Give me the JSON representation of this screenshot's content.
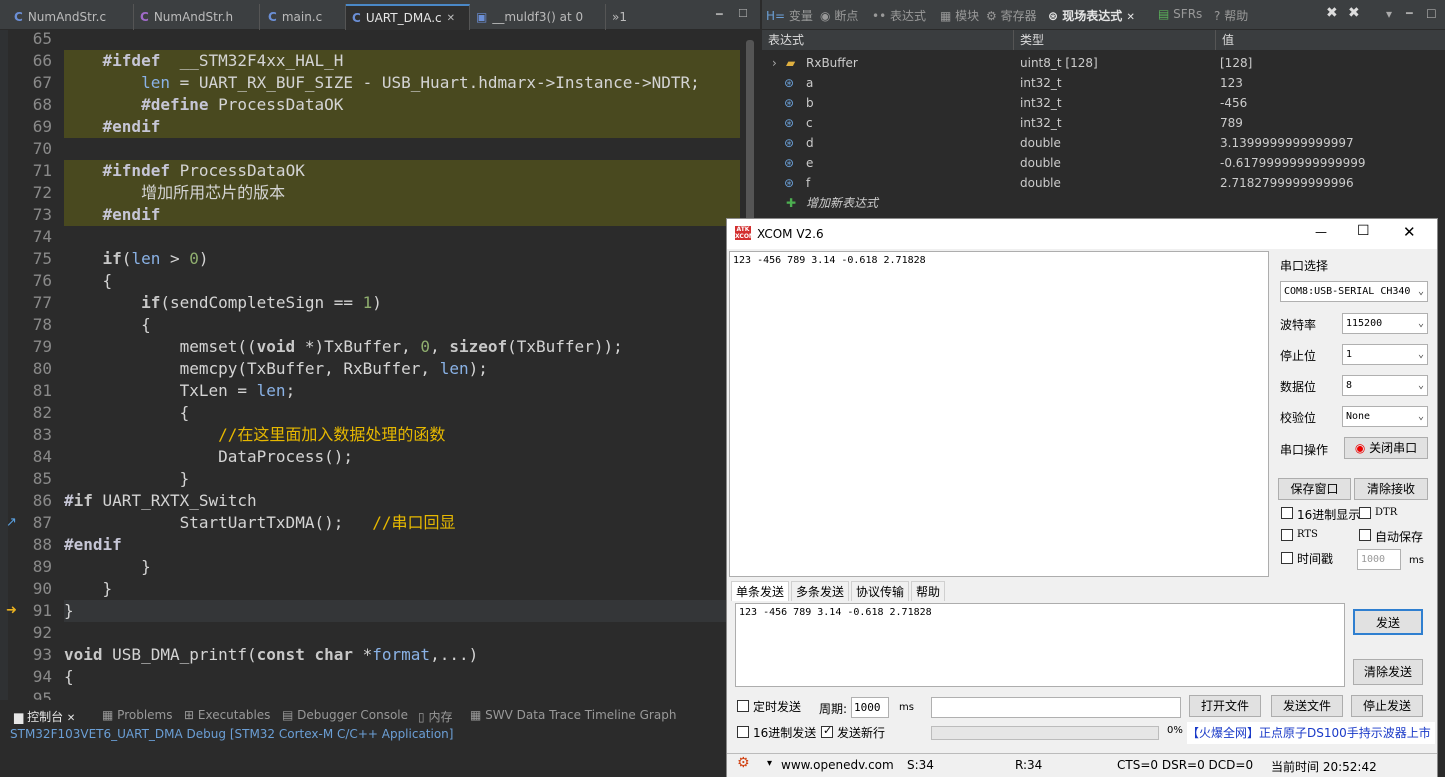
{
  "editor_tabs": [
    {
      "label": "NumAndStr.c",
      "type": "c"
    },
    {
      "label": "NumAndStr.h",
      "type": "h"
    },
    {
      "label": "main.c",
      "type": "c"
    },
    {
      "label": "UART_DMA.c",
      "type": "c"
    },
    {
      "label": "__muldf3() at 0",
      "type": "disasm"
    },
    {
      "label": "»1",
      "type": "more"
    }
  ],
  "code_lines": [
    {
      "n": "65",
      "t": ""
    },
    {
      "n": "66",
      "t": "    #ifdef  __STM32F4xx_HAL_H"
    },
    {
      "n": "67",
      "t": "        len = UART_RX_BUF_SIZE - USB_Huart.hdmarx->Instance->NDTR;"
    },
    {
      "n": "68",
      "t": "        #define ProcessDataOK"
    },
    {
      "n": "69",
      "t": "    #endif"
    },
    {
      "n": "70",
      "t": ""
    },
    {
      "n": "71",
      "t": "    #ifndef ProcessDataOK"
    },
    {
      "n": "72",
      "t": "        增加所用芯片的版本"
    },
    {
      "n": "73",
      "t": "    #endif"
    },
    {
      "n": "74",
      "t": ""
    },
    {
      "n": "75",
      "t": "    if(len > 0)"
    },
    {
      "n": "76",
      "t": "    {"
    },
    {
      "n": "77",
      "t": "        if(sendCompleteSign == 1)"
    },
    {
      "n": "78",
      "t": "        {"
    },
    {
      "n": "79",
      "t": "            memset((void *)TxBuffer, 0, sizeof(TxBuffer));"
    },
    {
      "n": "80",
      "t": "            memcpy(TxBuffer, RxBuffer, len);"
    },
    {
      "n": "81",
      "t": "            TxLen = len;"
    },
    {
      "n": "82",
      "t": "            {"
    },
    {
      "n": "83",
      "t": "                //在这里面加入数据处理的函数"
    },
    {
      "n": "84",
      "t": "                DataProcess();"
    },
    {
      "n": "85",
      "t": "            }"
    },
    {
      "n": "86",
      "t": "#if UART_RXTX_Switch"
    },
    {
      "n": "87",
      "t": "            StartUartTxDMA();   //串口回显"
    },
    {
      "n": "88",
      "t": "#endif"
    },
    {
      "n": "89",
      "t": "        }"
    },
    {
      "n": "90",
      "t": "    }"
    },
    {
      "n": "91",
      "t": "}"
    },
    {
      "n": "92",
      "t": ""
    },
    {
      "n": "93",
      "t": "void USB_DMA_printf(const char *format,...)"
    },
    {
      "n": "94",
      "t": "{"
    },
    {
      "n": "95",
      "t": ""
    }
  ],
  "right_tabs": [
    "变量",
    "断点",
    "表达式",
    "模块",
    "寄存器",
    "现场表达式",
    "SFRs",
    "帮助"
  ],
  "watch": {
    "headers": {
      "expr": "表达式",
      "type": "类型",
      "value": "值"
    },
    "rows": [
      {
        "expr": "RxBuffer",
        "type": "uint8_t [128]",
        "value": "[128]"
      },
      {
        "expr": "a",
        "type": "int32_t",
        "value": "123"
      },
      {
        "expr": "b",
        "type": "int32_t",
        "value": "-456"
      },
      {
        "expr": "c",
        "type": "int32_t",
        "value": "789"
      },
      {
        "expr": "d",
        "type": "double",
        "value": "3.1399999999999997"
      },
      {
        "expr": "e",
        "type": "double",
        "value": "-0.61799999999999999"
      },
      {
        "expr": "f",
        "type": "double",
        "value": "2.7182799999999996"
      }
    ],
    "add_label": "增加新表达式"
  },
  "console": {
    "tabs": [
      "控制台",
      "Problems",
      "Executables",
      "Debugger Console",
      "内存",
      "SWV Data Trace Timeline Graph"
    ],
    "status": "STM32F103VET6_UART_DMA Debug [STM32 Cortex-M C/C++ Application]"
  },
  "xcom": {
    "title": "XCOM V2.6",
    "receive_text": "123 -456 789 3.14 -0.618 2.71828",
    "port_label": "串口选择",
    "port_value": "COM8:USB-SERIAL CH340",
    "baud_label": "波特率",
    "baud_value": "115200",
    "stop_label": "停止位",
    "stop_value": "1",
    "data_label": "数据位",
    "data_value": "8",
    "parity_label": "校验位",
    "parity_value": "None",
    "op_label": "串口操作",
    "close_port": "关闭串口",
    "save_window": "保存窗口",
    "clear_recv": "清除接收",
    "hex_display": "16进制显示",
    "dtr": "DTR",
    "rts": "RTS",
    "auto_save": "自动保存",
    "timestamp": "时间戳",
    "timestamp_ms": "1000",
    "ms": "ms",
    "send_tabs": [
      "单条发送",
      "多条发送",
      "协议传输",
      "帮助"
    ],
    "send_text": "123 -456 789 3.14 -0.618 2.71828",
    "send_btn": "发送",
    "clear_send": "清除发送",
    "timed_send": "定时发送",
    "period_label": "周期:",
    "period_value": "1000",
    "open_file": "打开文件",
    "send_file": "发送文件",
    "stop_send": "停止发送",
    "hex_send": "16进制发送",
    "newline_send": "发送新行",
    "progress": "0%",
    "ad_text": "【火爆全网】正点原子DS100手持示波器上市",
    "status_url": "www.openedv.com",
    "status_s": "S:34",
    "status_r": "R:34",
    "status_lines": "CTS=0 DSR=0 DCD=0",
    "status_time": "当前时间 20:52:42"
  }
}
